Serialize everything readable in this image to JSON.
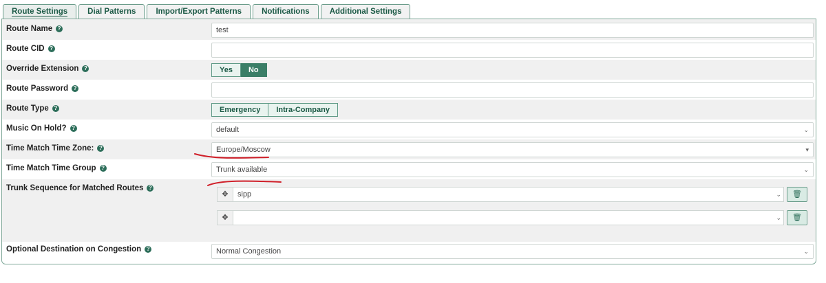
{
  "tabs": [
    {
      "label": "Route Settings",
      "active": true
    },
    {
      "label": "Dial Patterns"
    },
    {
      "label": "Import/Export Patterns"
    },
    {
      "label": "Notifications"
    },
    {
      "label": "Additional Settings"
    }
  ],
  "fields": {
    "route_name": {
      "label": "Route Name",
      "value": "test"
    },
    "route_cid": {
      "label": "Route CID",
      "value": ""
    },
    "override_extension": {
      "label": "Override Extension",
      "options": [
        "Yes",
        "No"
      ],
      "selected": "No"
    },
    "route_password": {
      "label": "Route Password",
      "value": ""
    },
    "route_type": {
      "label": "Route Type",
      "options": [
        "Emergency",
        "Intra-Company"
      ]
    },
    "music_on_hold": {
      "label": "Music On Hold?",
      "value": "default"
    },
    "time_zone": {
      "label": "Time Match Time Zone:",
      "value": "Europe/Moscow"
    },
    "time_group": {
      "label": "Time Match Time Group",
      "value": "Trunk available"
    },
    "trunk_sequence": {
      "label": "Trunk Sequence for Matched Routes",
      "trunks": [
        "sipp",
        ""
      ]
    },
    "congestion": {
      "label": "Optional Destination on Congestion",
      "value": "Normal Congestion"
    }
  },
  "icons": {
    "help": "question-circle-icon",
    "move": "move-arrows-icon",
    "trash": "trash-icon",
    "chevron": "chevron-down-icon"
  },
  "colors": {
    "accent": "#3b7e67",
    "annotation": "#d0202a"
  }
}
